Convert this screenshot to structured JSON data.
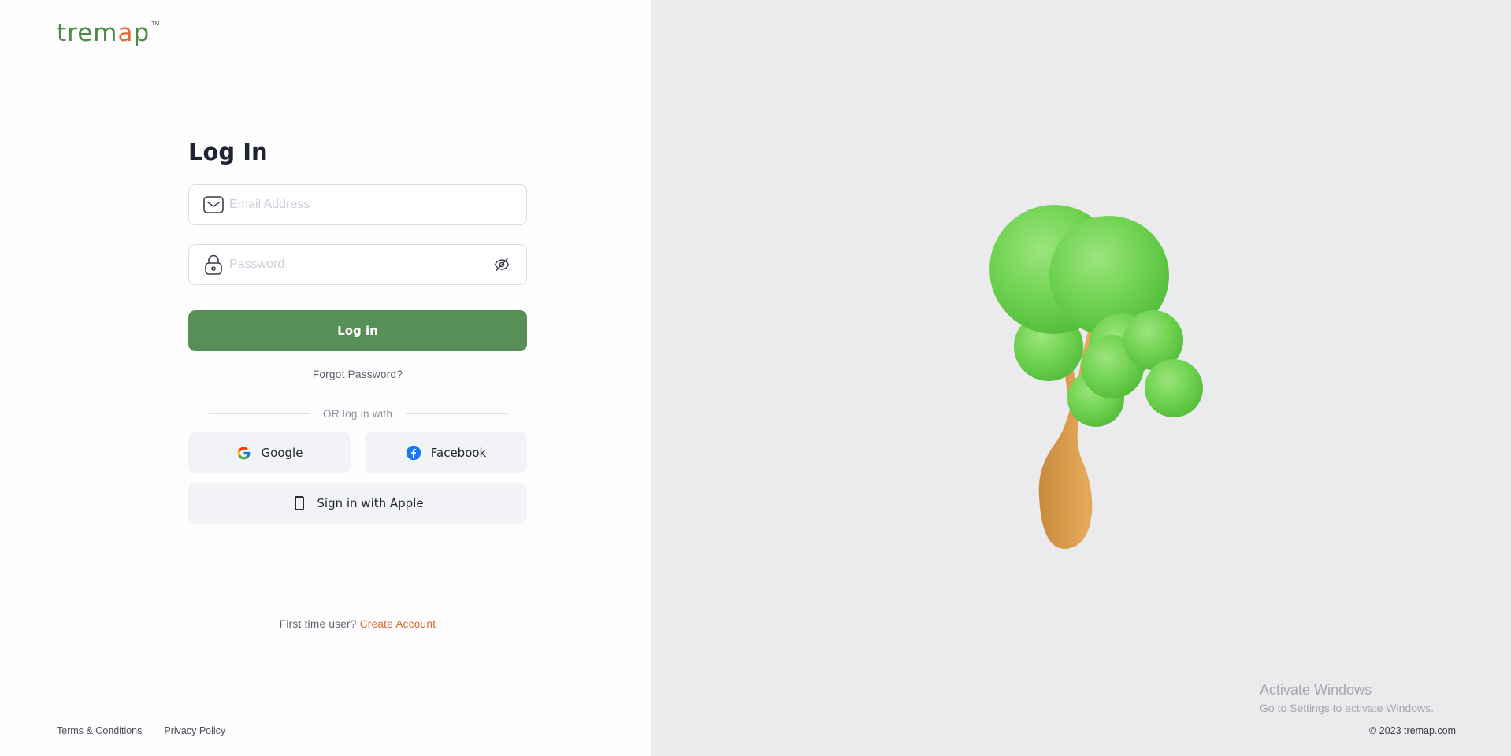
{
  "brand": {
    "logo_prefix": "trem",
    "logo_accent": "a",
    "logo_suffix": "p",
    "trademark": "TM",
    "primary_color": "#578f57",
    "accent_color": "#e06b32"
  },
  "form": {
    "title": "Log In",
    "email": {
      "placeholder": "Email Address",
      "value": "",
      "icon": "mail-icon"
    },
    "password": {
      "placeholder": "Password",
      "value": "",
      "icon": "lock-icon",
      "toggle_icon": "eye-off-icon"
    },
    "login_button": "Log in",
    "forgot_password": "Forgot Password?",
    "divider_text": "OR log in with"
  },
  "social": {
    "google": {
      "label": "Google",
      "icon": "google-icon"
    },
    "facebook": {
      "label": "Facebook",
      "icon": "facebook-icon"
    },
    "apple": {
      "label": "Sign in with Apple",
      "icon": "phone-icon"
    }
  },
  "signup": {
    "prompt": "First time user?",
    "link": "Create Account"
  },
  "footer": {
    "terms": "Terms & Conditions",
    "privacy": "Privacy Policy",
    "copyright": "© 2023 tremap.com"
  },
  "windows_watermark": {
    "line1": "Activate Windows",
    "line2": "Go to Settings to activate Windows."
  }
}
